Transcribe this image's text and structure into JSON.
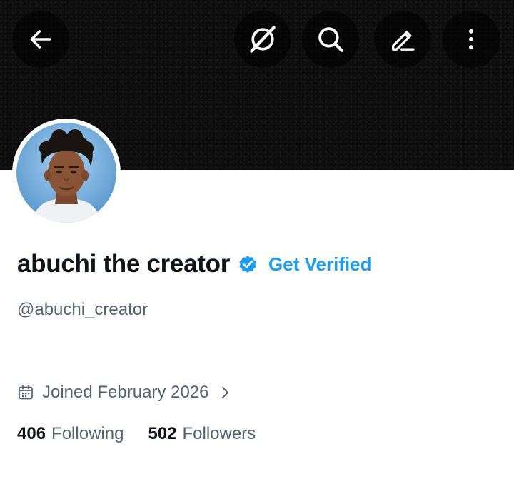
{
  "header": {
    "back_icon": "arrow-left-icon",
    "grok_icon": "grok-slash-icon",
    "search_icon": "search-icon",
    "edit_icon": "pencil-icon",
    "more_icon": "more-vertical-icon"
  },
  "profile": {
    "display_name": "abuchi the creator",
    "verified_badge_icon": "verified-badge-icon",
    "get_verified_label": "Get Verified",
    "handle": "@abuchi_creator",
    "joined": "Joined February 2026",
    "following_count": "406",
    "following_label": "Following",
    "followers_count": "502",
    "followers_label": "Followers"
  },
  "colors": {
    "accent": "#1d9bf0",
    "text_primary": "#0f1419",
    "text_secondary": "#536471",
    "banner": "#0c0c0c"
  }
}
